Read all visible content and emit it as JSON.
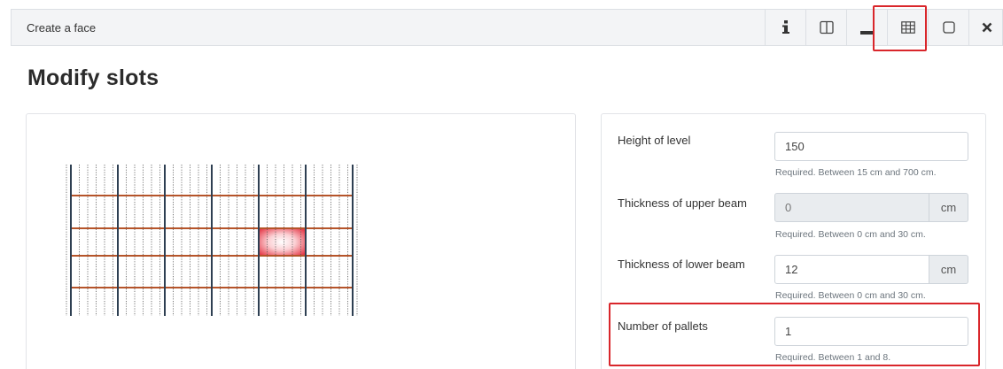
{
  "header": {
    "title": "Create a face",
    "buttons": [
      {
        "name": "info-button",
        "icon": "info-icon"
      },
      {
        "name": "split-view-button",
        "icon": "columns-icon"
      },
      {
        "name": "minimize-button",
        "icon": "minimize-icon"
      },
      {
        "name": "grid-view-button",
        "icon": "table-icon"
      },
      {
        "name": "maximize-button",
        "icon": "square-icon"
      },
      {
        "name": "close-button",
        "icon": "close-icon"
      }
    ]
  },
  "page": {
    "title": "Modify slots"
  },
  "form": {
    "height_of_level": {
      "label": "Height of level",
      "value": "150",
      "help": "Required. Between 15 cm and 700 cm."
    },
    "upper_beam": {
      "label": "Thickness of upper beam",
      "value": "0",
      "unit": "cm",
      "help": "Required. Between 0 cm and 30 cm."
    },
    "lower_beam": {
      "label": "Thickness of lower beam",
      "value": "12",
      "unit": "cm",
      "help": "Required. Between 0 cm and 30 cm."
    },
    "pallets": {
      "label": "Number of pallets",
      "value": "1",
      "help": "Required. Between 1 and 8."
    }
  },
  "colors": {
    "upright": "#2e3f52",
    "beam": "#b5542a",
    "selected_slot": "#e53b4a",
    "highlight": "#d9262b"
  }
}
